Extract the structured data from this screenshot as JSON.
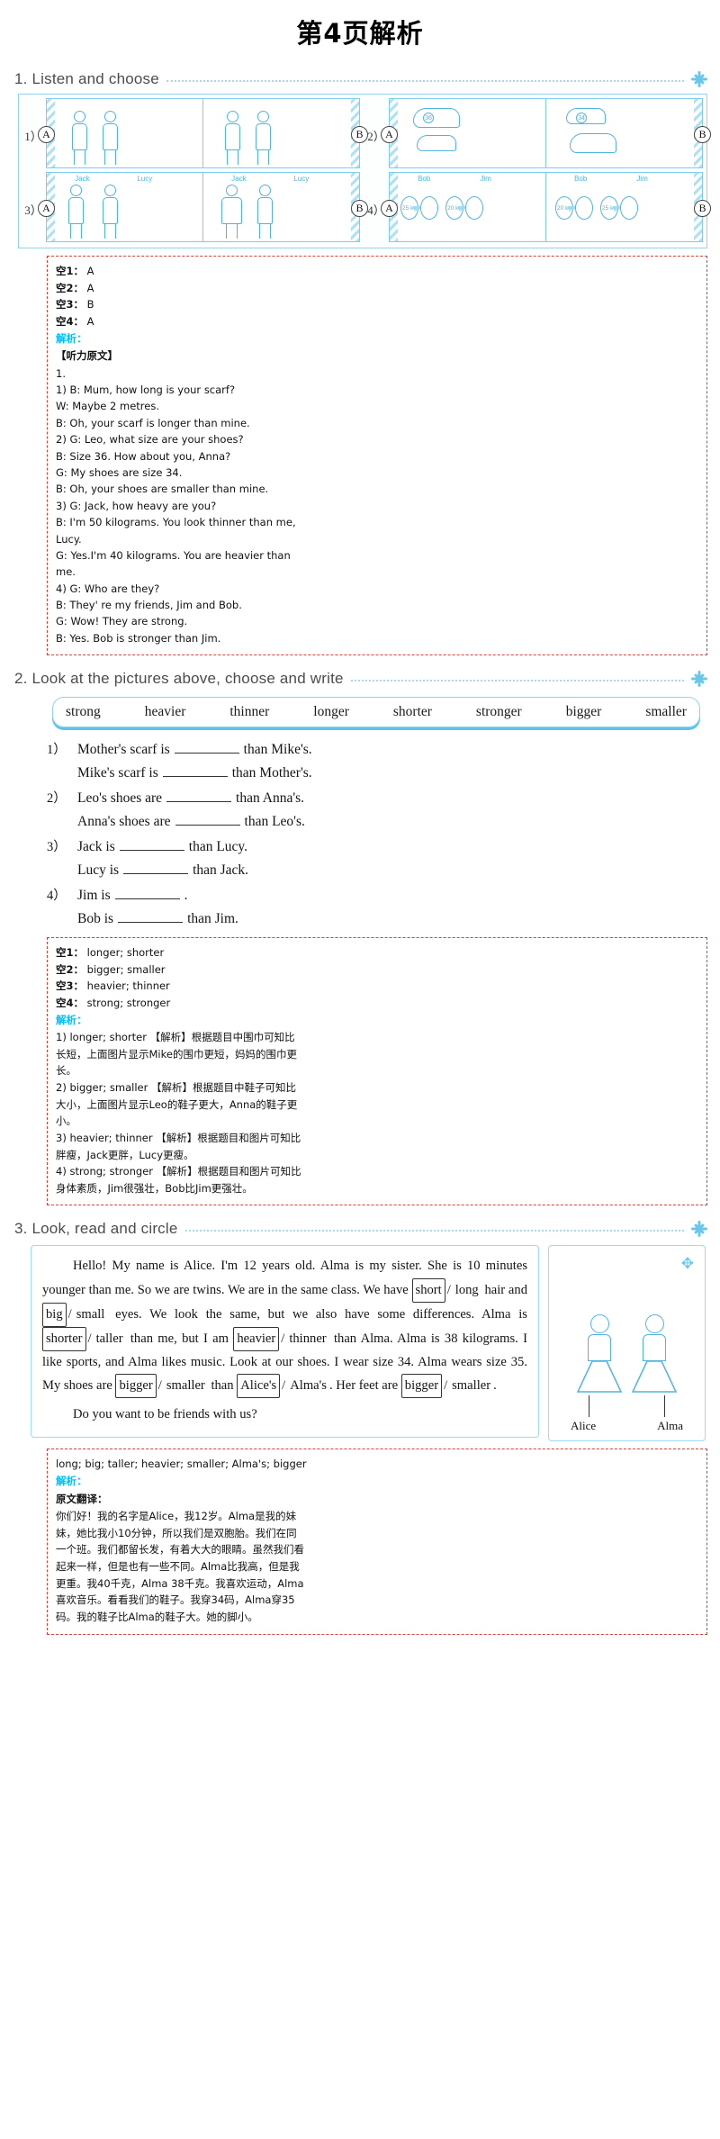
{
  "page": {
    "title": "第4页解析",
    "accent_blue": "#69c7ea",
    "answer_border_red": "#e03c31",
    "jiexi_cyan": "#00bfff"
  },
  "sections": [
    {
      "id": "ex1",
      "heading": "1. Listen and choose",
      "pictures": {
        "rows": [
          {
            "qnum": "1）",
            "left_badge": "A",
            "right_badge": "B",
            "caption_names": [],
            "kind": "people-scarf"
          },
          {
            "qnum": "2）",
            "left_badge": "A",
            "right_badge": "B",
            "caption_names": [],
            "kind": "shoes",
            "shoe_sizes": [
              "36",
              "34"
            ]
          },
          {
            "qnum": "3）",
            "left_badge": "A",
            "right_badge": "B",
            "caption_names": [
              "Jack",
              "Lucy",
              "Jack",
              "Lucy"
            ],
            "kind": "people-weight"
          },
          {
            "qnum": "4）",
            "left_badge": "A",
            "right_badge": "B",
            "caption_names": [
              "Bob",
              "Jim",
              "Bob",
              "Jim"
            ],
            "kind": "dumbbells",
            "weights": [
              "25 kg",
              "20 kg",
              "20 kg",
              "25 kg"
            ]
          }
        ]
      },
      "answers": [
        {
          "key": "空1：",
          "value": "A"
        },
        {
          "key": "空2：",
          "value": "A"
        },
        {
          "key": "空3：",
          "value": "B"
        },
        {
          "key": "空4：",
          "value": "A"
        }
      ],
      "jiexi_label": "解析：",
      "transcript_heading": "【听力原文】",
      "transcript": [
        "1.",
        "1) B: Mum, how long is your scarf?",
        "W: Maybe 2 metres.",
        "B: Oh, your scarf is longer than mine.",
        "2) G: Leo, what size are your shoes?",
        "B: Size 36. How about you, Anna?",
        "G: My shoes are size 34.",
        "B: Oh, your shoes are smaller than mine.",
        "3) G: Jack, how heavy are you?",
        "B: I'm 50 kilograms. You look thinner than me,",
        "Lucy.",
        "G: Yes.I'm 40 kilograms. You are heavier than",
        "me.",
        "4) G: Who are they?",
        "B: They' re my friends, Jim and Bob.",
        "G: Wow! They are strong.",
        "B: Yes. Bob is stronger than Jim."
      ]
    },
    {
      "id": "ex2",
      "heading": "2. Look at the pictures above, choose and write",
      "wordbank": [
        "strong",
        "heavier",
        "thinner",
        "longer",
        "shorter",
        "stronger",
        "bigger",
        "smaller"
      ],
      "questions": [
        {
          "label": "1）",
          "lines": [
            {
              "pre": "Mother's scarf is",
              "post": "than Mike's."
            },
            {
              "pre": "Mike's scarf is",
              "post": "than Mother's."
            }
          ]
        },
        {
          "label": "2）",
          "lines": [
            {
              "pre": "Leo's shoes are",
              "post": "than Anna's."
            },
            {
              "pre": "Anna's shoes are",
              "post": "than Leo's."
            }
          ]
        },
        {
          "label": "3）",
          "lines": [
            {
              "pre": "Jack is",
              "post": "than Lucy."
            },
            {
              "pre": "Lucy is",
              "post": "than Jack."
            }
          ]
        },
        {
          "label": "4）",
          "lines": [
            {
              "pre": "Jim is",
              "post": "."
            },
            {
              "pre": "Bob is",
              "post": "than Jim."
            }
          ]
        }
      ],
      "answers": [
        {
          "key": "空1：",
          "value": "longer; shorter"
        },
        {
          "key": "空2：",
          "value": "bigger; smaller"
        },
        {
          "key": "空3：",
          "value": "heavier; thinner"
        },
        {
          "key": "空4：",
          "value": "strong; stronger"
        }
      ],
      "jiexi_label": "解析：",
      "explanations": [
        "1) longer; shorter 【解析】根据题目中围巾可知比",
        "长短，上面图片显示Mike的围巾更短，妈妈的围巾更",
        "长。",
        "2) bigger; smaller 【解析】根据题目中鞋子可知比",
        "大小，上面图片显示Leo的鞋子更大，Anna的鞋子更",
        "小。",
        "3) heavier; thinner 【解析】根据题目和图片可知比",
        "胖瘦，Jack更胖，Lucy更瘦。",
        "4) strong; stronger 【解析】根据题目和图片可知比",
        "身体素质，Jim很强壮，Bob比Jim更强壮。"
      ]
    },
    {
      "id": "ex3",
      "heading": "3. Look, read and circle",
      "passage_segments": [
        {
          "type": "indent"
        },
        {
          "type": "text",
          "value": "Hello! My name is Alice. I'm 12 years old. Alma is my sister. She is 10 minutes younger than me. So we are twins. We are in the same class. We have "
        },
        {
          "type": "choice",
          "a": "short",
          "b": "long",
          "boxed": "a"
        },
        {
          "type": "text",
          "value": " hair and "
        },
        {
          "type": "choice",
          "a": "big",
          "b": "small",
          "boxed": "a"
        },
        {
          "type": "text",
          "value": " eyes. We look the same, but we also have some differences. Alma is "
        },
        {
          "type": "choice",
          "a": "shorter",
          "b": "taller",
          "boxed": "a"
        },
        {
          "type": "text",
          "value": " than me, but I am "
        },
        {
          "type": "choice",
          "a": "heavier",
          "b": "thinner",
          "boxed": "a"
        },
        {
          "type": "text",
          "value": " than Alma. Alma is 38 kilograms. I like sports, and Alma likes music. Look at our shoes. I wear size 34. Alma wears size 35. My shoes are "
        },
        {
          "type": "choice",
          "a": "bigger",
          "b": "smaller",
          "boxed": "a"
        },
        {
          "type": "text",
          "value": " than "
        },
        {
          "type": "choice",
          "a": "Alice's",
          "b": "Alma's",
          "boxed": "a"
        },
        {
          "type": "text",
          "value": ". Her feet are "
        },
        {
          "type": "choice",
          "a": "bigger",
          "b": "smaller",
          "boxed": "a"
        },
        {
          "type": "text",
          "value": "."
        },
        {
          "type": "break"
        },
        {
          "type": "indent"
        },
        {
          "type": "text",
          "value": "Do you want to be friends with us?"
        }
      ],
      "picture_captions": [
        "Alice",
        "Alma"
      ],
      "answer_line": "long; big; taller; heavier; smaller; Alma's; bigger",
      "jiexi_label": "解析：",
      "translation_heading": "原文翻译：",
      "translation": [
        "你们好！我的名字是Alice，我12岁。Alma是我的妹",
        "妹，她比我小10分钟，所以我们是双胞胎。我们在同",
        "一个班。我们都留长发，有着大大的眼睛。虽然我们看",
        "起来一样，但是也有一些不同。Alma比我高，但是我",
        "更重。我40千克，Alma 38千克。我喜欢运动，Alma",
        "喜欢音乐。看看我们的鞋子。我穿34码，Alma穿35",
        "码。我的鞋子比Alma的鞋子大。她的脚小。"
      ]
    }
  ]
}
